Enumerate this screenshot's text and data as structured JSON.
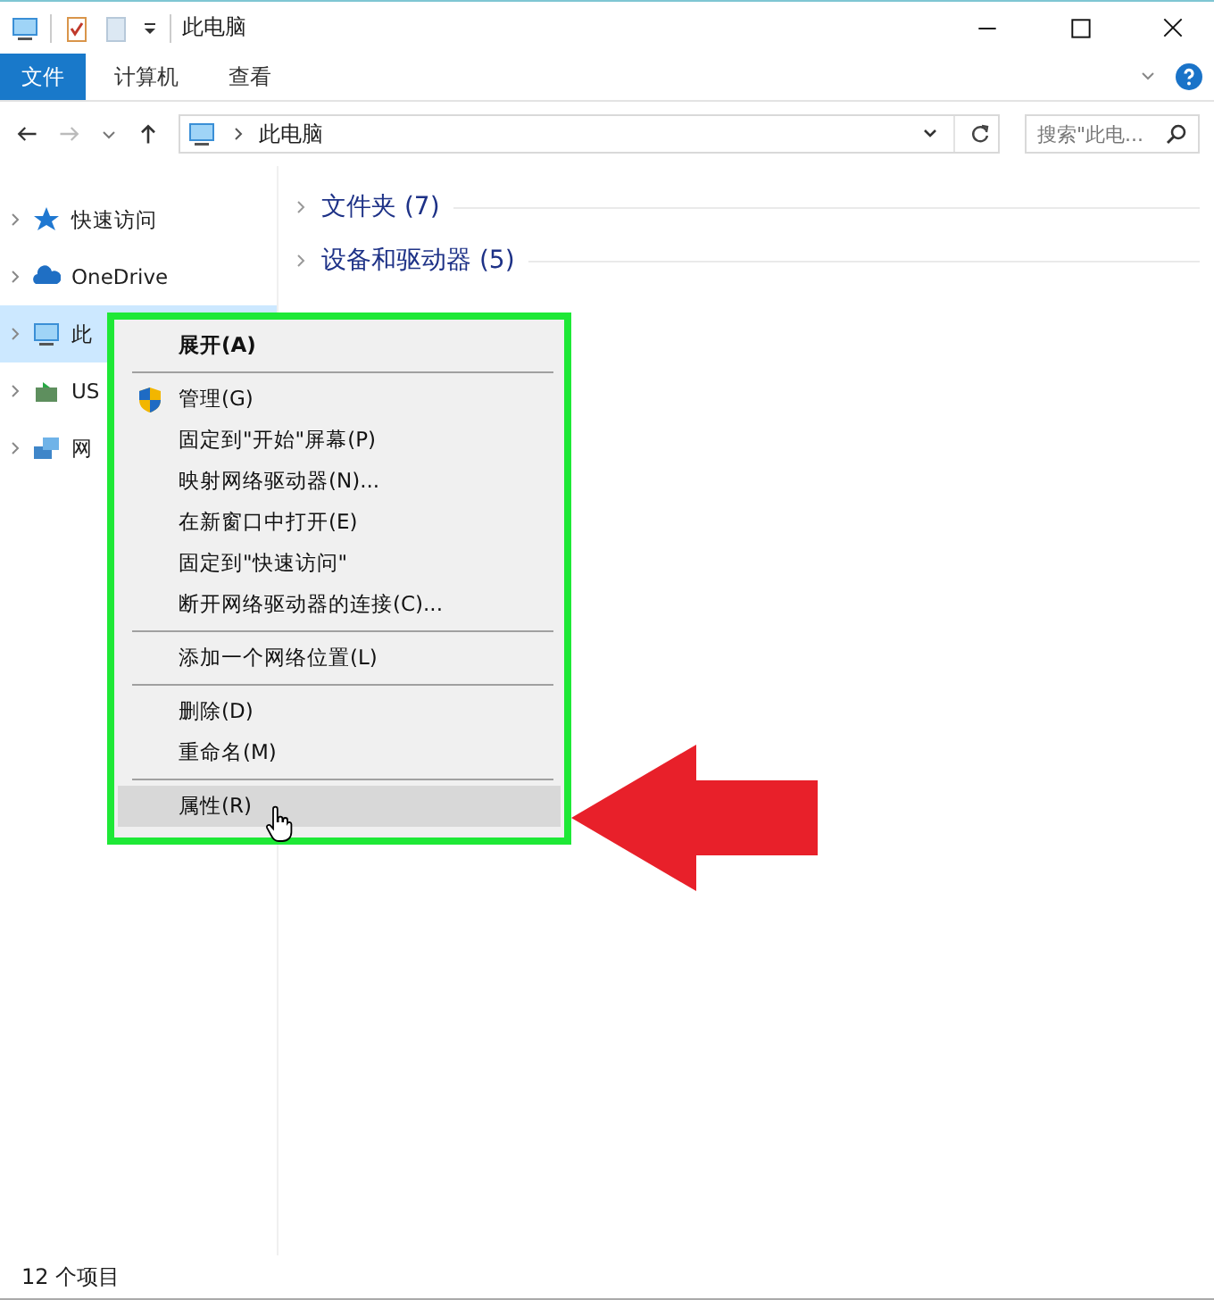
{
  "window": {
    "title": "此电脑"
  },
  "ribbon_tabs": [
    {
      "label": "文件",
      "selected": true
    },
    {
      "label": "计算机",
      "selected": false
    },
    {
      "label": "查看",
      "selected": false
    }
  ],
  "address": {
    "path": "此电脑"
  },
  "search": {
    "placeholder": "搜索\"此电..."
  },
  "sidebar": {
    "items": [
      {
        "label": "快速访问",
        "selected": false
      },
      {
        "label": "OneDrive",
        "selected": false
      },
      {
        "label": "此",
        "selected": true
      },
      {
        "label": "US",
        "selected": false
      },
      {
        "label": "网",
        "selected": false
      }
    ]
  },
  "groups": [
    {
      "label": "文件夹 (7)"
    },
    {
      "label": "设备和驱动器 (5)"
    }
  ],
  "context_menu": {
    "items": [
      {
        "kind": "item",
        "label": "展开(A)",
        "bold": true,
        "selected": false
      },
      {
        "kind": "separator"
      },
      {
        "kind": "item",
        "label": "管理(G)",
        "selected": false
      },
      {
        "kind": "item",
        "label": "固定到\"开始\"屏幕(P)",
        "selected": false
      },
      {
        "kind": "item",
        "label": "映射网络驱动器(N)...",
        "selected": false
      },
      {
        "kind": "item",
        "label": "在新窗口中打开(E)",
        "selected": false
      },
      {
        "kind": "item",
        "label": "固定到\"快速访问\"",
        "selected": false
      },
      {
        "kind": "item",
        "label": "断开网络驱动器的连接(C)...",
        "selected": false
      },
      {
        "kind": "separator"
      },
      {
        "kind": "item",
        "label": "添加一个网络位置(L)",
        "selected": false
      },
      {
        "kind": "separator"
      },
      {
        "kind": "item",
        "label": "删除(D)",
        "selected": false
      },
      {
        "kind": "item",
        "label": "重命名(M)",
        "selected": false
      },
      {
        "kind": "separator"
      },
      {
        "kind": "item",
        "label": "属性(R)",
        "selected": true
      }
    ]
  },
  "status_bar": {
    "text": "12 个项目"
  }
}
